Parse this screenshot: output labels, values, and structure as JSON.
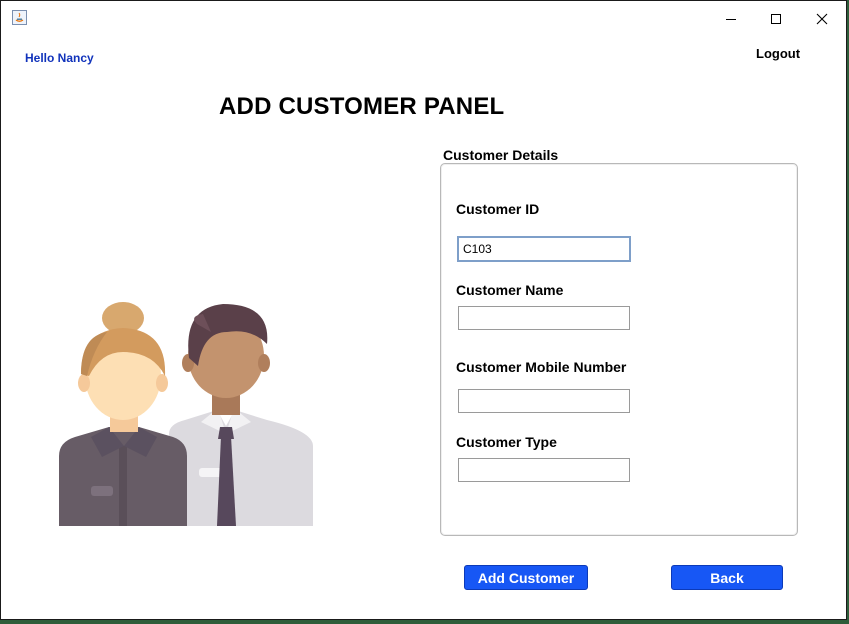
{
  "window": {
    "controls": {
      "minimize_icon": "minimize-icon",
      "maximize_icon": "maximize-icon",
      "close_icon": "close-icon"
    }
  },
  "header": {
    "greeting": "Hello Nancy",
    "logout_label": "Logout",
    "title": "ADD CUSTOMER PANEL"
  },
  "form": {
    "caption": "Customer Details",
    "fields": [
      {
        "label": "Customer ID",
        "value": "C103"
      },
      {
        "label": "Customer Name",
        "value": ""
      },
      {
        "label": "Customer Mobile Number",
        "value": ""
      },
      {
        "label": "Customer Type",
        "value": ""
      }
    ]
  },
  "actions": {
    "add_label": "Add Customer",
    "back_label": "Back"
  },
  "colors": {
    "accent": "#1757f5",
    "greeting": "#1133bb"
  }
}
